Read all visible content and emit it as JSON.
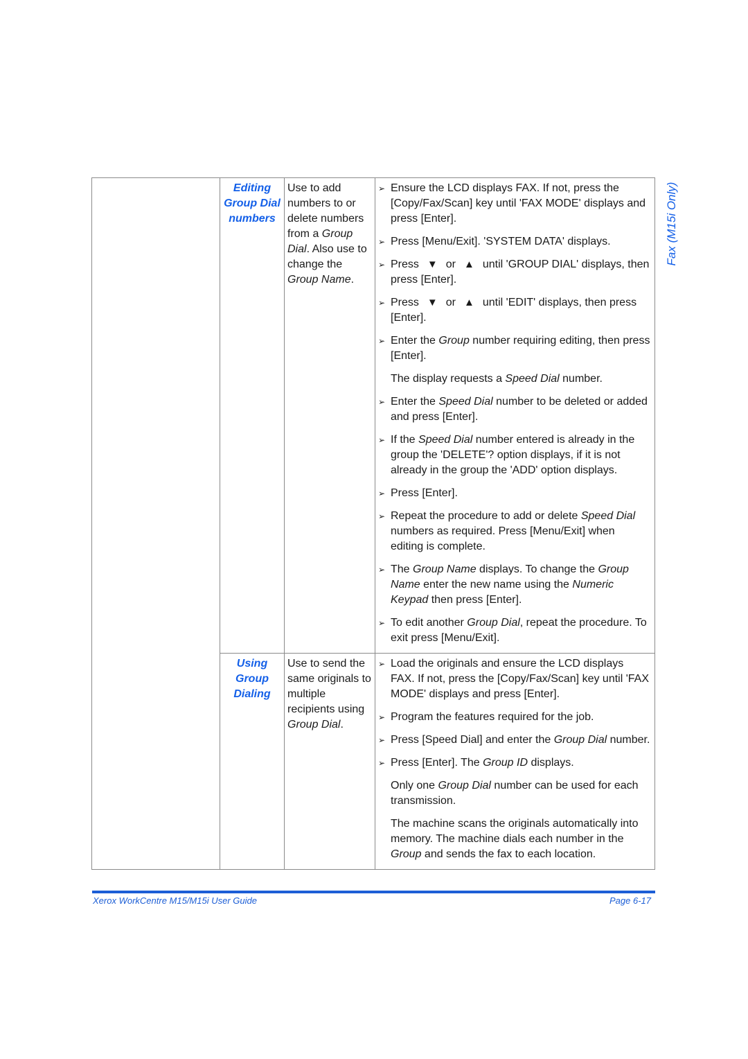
{
  "side_tab": {
    "label": "Fax (M15i Only)"
  },
  "sections": [
    {
      "title_lines": [
        "Editing",
        "Group Dial",
        "numbers"
      ],
      "description": [
        {
          "t": "Use to add numbers to or delete numbers from a ",
          "i": false
        },
        {
          "t": "Group Dial",
          "i": true
        },
        {
          "t": ". Also use to change the ",
          "i": false
        },
        {
          "t": "Group Name",
          "i": true
        },
        {
          "t": ".",
          "i": false
        }
      ],
      "steps": [
        {
          "type": "bullet",
          "parts": [
            {
              "t": "Ensure the LCD displays FAX. If not, press the [Copy/Fax/Scan] key until 'FAX MODE' displays and press [Enter].",
              "i": false
            }
          ]
        },
        {
          "type": "bullet",
          "parts": [
            {
              "t": "Press [Menu/Exit]. 'SYSTEM DATA' displays.",
              "i": false
            }
          ]
        },
        {
          "type": "bullet",
          "parts": [
            {
              "t": "Press",
              "i": false
            },
            {
              "arrow": "down"
            },
            {
              "t": "or",
              "i": false
            },
            {
              "arrow": "up"
            },
            {
              "t": "until 'GROUP DIAL' displays, then press [Enter].",
              "i": false
            }
          ]
        },
        {
          "type": "bullet",
          "parts": [
            {
              "t": "Press",
              "i": false
            },
            {
              "arrow": "down"
            },
            {
              "t": "or",
              "i": false
            },
            {
              "arrow": "up"
            },
            {
              "t": "until 'EDIT' displays, then press [Enter].",
              "i": false
            }
          ]
        },
        {
          "type": "bullet",
          "parts": [
            {
              "t": "Enter the ",
              "i": false
            },
            {
              "t": "Group",
              "i": true
            },
            {
              "t": " number requiring editing, then press [Enter].",
              "i": false
            }
          ]
        },
        {
          "type": "note",
          "parts": [
            {
              "t": "The display requests a ",
              "i": false
            },
            {
              "t": "Speed Dial",
              "i": true
            },
            {
              "t": " number.",
              "i": false
            }
          ]
        },
        {
          "type": "bullet",
          "parts": [
            {
              "t": "Enter the ",
              "i": false
            },
            {
              "t": "Speed Dial",
              "i": true
            },
            {
              "t": " number to be deleted or added and press [Enter].",
              "i": false
            }
          ]
        },
        {
          "type": "bullet",
          "parts": [
            {
              "t": "If the ",
              "i": false
            },
            {
              "t": "Speed Dial",
              "i": true
            },
            {
              "t": " number entered is already in the group the 'DELETE'? option displays, if it is not already in the group the 'ADD' option displays.",
              "i": false
            }
          ]
        },
        {
          "type": "bullet",
          "parts": [
            {
              "t": "Press [Enter].",
              "i": false
            }
          ]
        },
        {
          "type": "bullet",
          "parts": [
            {
              "t": "Repeat the procedure to add or delete ",
              "i": false
            },
            {
              "t": "Speed Dial",
              "i": true
            },
            {
              "t": " numbers as required. Press [Menu/Exit] when editing is complete.",
              "i": false
            }
          ]
        },
        {
          "type": "bullet",
          "parts": [
            {
              "t": "The ",
              "i": false
            },
            {
              "t": "Group Name",
              "i": true
            },
            {
              "t": " displays. To change the ",
              "i": false
            },
            {
              "t": "Group Name",
              "i": true
            },
            {
              "t": " enter the new name using the ",
              "i": false
            },
            {
              "t": "Numeric Keypad",
              "i": true
            },
            {
              "t": " then press [Enter].",
              "i": false
            }
          ]
        },
        {
          "type": "bullet",
          "parts": [
            {
              "t": "To edit another ",
              "i": false
            },
            {
              "t": "Group Dial",
              "i": true
            },
            {
              "t": ", repeat the procedure. To exit press [Menu/Exit].",
              "i": false
            }
          ]
        }
      ]
    },
    {
      "title_lines": [
        "Using",
        "Group",
        "Dialing"
      ],
      "description": [
        {
          "t": "Use to send the same originals to multiple recipients using ",
          "i": false
        },
        {
          "t": "Group Dial",
          "i": true
        },
        {
          "t": ".",
          "i": false
        }
      ],
      "steps": [
        {
          "type": "bullet",
          "parts": [
            {
              "t": "Load the originals and ensure the LCD displays FAX. If not, press the [Copy/Fax/Scan] key until 'FAX MODE' displays and press [Enter].",
              "i": false
            }
          ]
        },
        {
          "type": "bullet",
          "parts": [
            {
              "t": "Program the features required for the job.",
              "i": false
            }
          ]
        },
        {
          "type": "bullet",
          "parts": [
            {
              "t": "Press [Speed Dial] and enter the ",
              "i": false
            },
            {
              "t": "Group Dial",
              "i": true
            },
            {
              "t": " number.",
              "i": false
            }
          ]
        },
        {
          "type": "bullet",
          "parts": [
            {
              "t": "Press [Enter]. The ",
              "i": false
            },
            {
              "t": "Group ID",
              "i": true
            },
            {
              "t": " displays.",
              "i": false
            }
          ]
        },
        {
          "type": "note",
          "parts": [
            {
              "t": "Only one ",
              "i": false
            },
            {
              "t": "Group Dial",
              "i": true
            },
            {
              "t": " number can be used for each transmission.",
              "i": false
            }
          ]
        },
        {
          "type": "note",
          "parts": [
            {
              "t": "The machine scans the originals automatically into memory. The machine dials each number in the ",
              "i": false
            },
            {
              "t": "Group",
              "i": true
            },
            {
              "t": " and sends the fax to each location.",
              "i": false
            }
          ]
        }
      ]
    }
  ],
  "icons": {
    "bullet": "arrowhead-bullet-icon",
    "down": "down-arrow-key-icon",
    "up": "up-arrow-key-icon"
  },
  "footer": {
    "guide_title": "Xerox WorkCentre M15/M15i User Guide",
    "page_label": "Page 6-17"
  },
  "colors": {
    "accent": "#1460e8",
    "footer_rule": "#1c5ed6",
    "border": "#8a8a8a"
  }
}
